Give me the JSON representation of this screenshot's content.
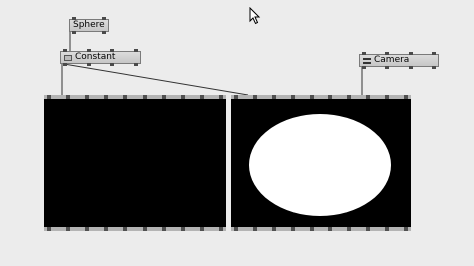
{
  "nodes": {
    "sphere": {
      "label": "Sphere"
    },
    "constant": {
      "label": "Constant"
    },
    "camera": {
      "label": "Camera"
    }
  },
  "viewers": {
    "left": {
      "content": "black"
    },
    "right": {
      "content": "white-sphere-on-black"
    }
  },
  "colors": {
    "background": "#ececec",
    "node_fill": "#d0d0d0",
    "viewer_frame": "#b4b4b4",
    "render_black": "#000000",
    "render_white": "#ffffff"
  },
  "icons": [
    "constant-node-icon",
    "camera-node-icon",
    "mouse-pointer-icon"
  ]
}
